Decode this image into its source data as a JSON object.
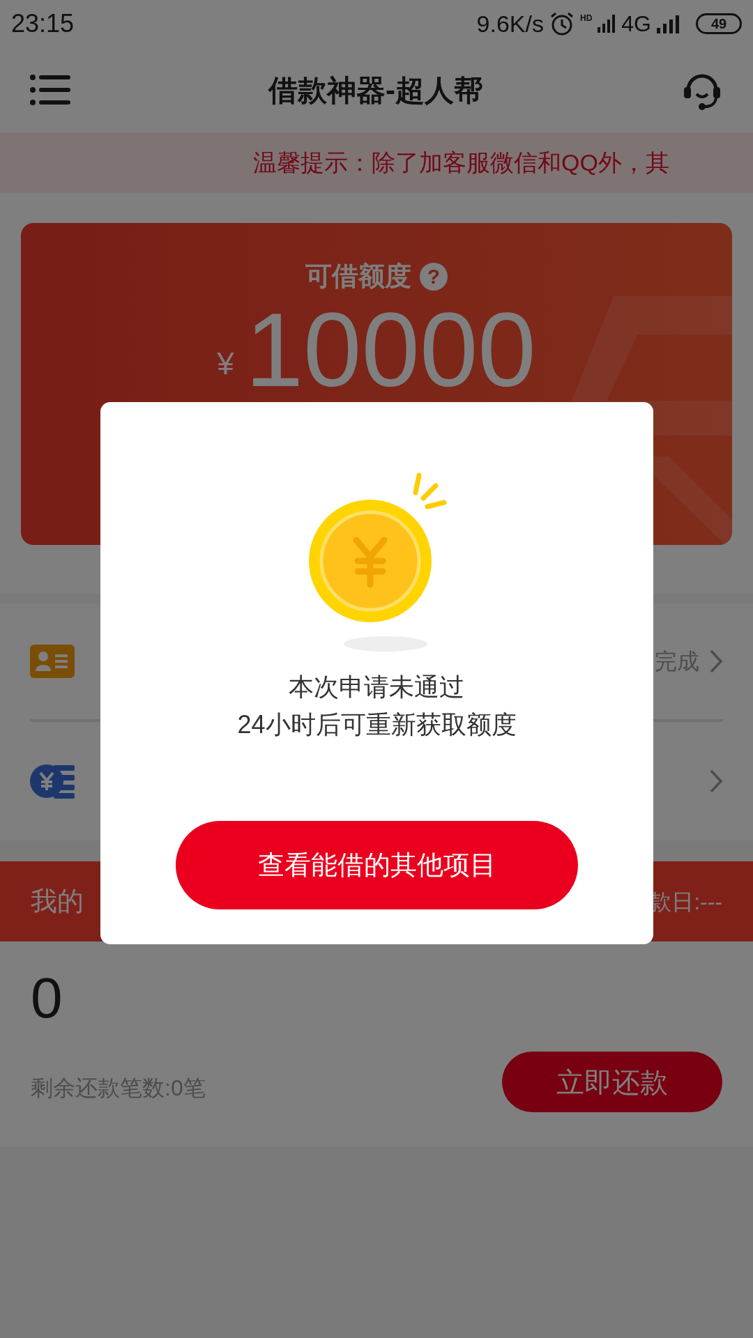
{
  "status_bar": {
    "time": "23:15",
    "speed": "9.6K/s",
    "hd": "HD",
    "network": "4G",
    "battery": "49"
  },
  "header": {
    "title": "借款神器-超人帮"
  },
  "notice": {
    "text": "温馨提示：除了加客服微信和QQ外，其"
  },
  "quota_card": {
    "label": "可借额度",
    "help": "?",
    "currency": "¥",
    "amount": "10000"
  },
  "items": [
    {
      "kind": "profile",
      "status": "完成"
    },
    {
      "kind": "payment"
    }
  ],
  "loan_bar": {
    "left": "我的",
    "right": "款日:---"
  },
  "loan": {
    "amount": "0",
    "remaining": "剩余还款笔数:0笔",
    "button": "立即还款"
  },
  "dialog": {
    "lines": [
      "本次申请未通过",
      "24小时后可重新获取额度"
    ],
    "button": "查看能借的其他项目"
  }
}
